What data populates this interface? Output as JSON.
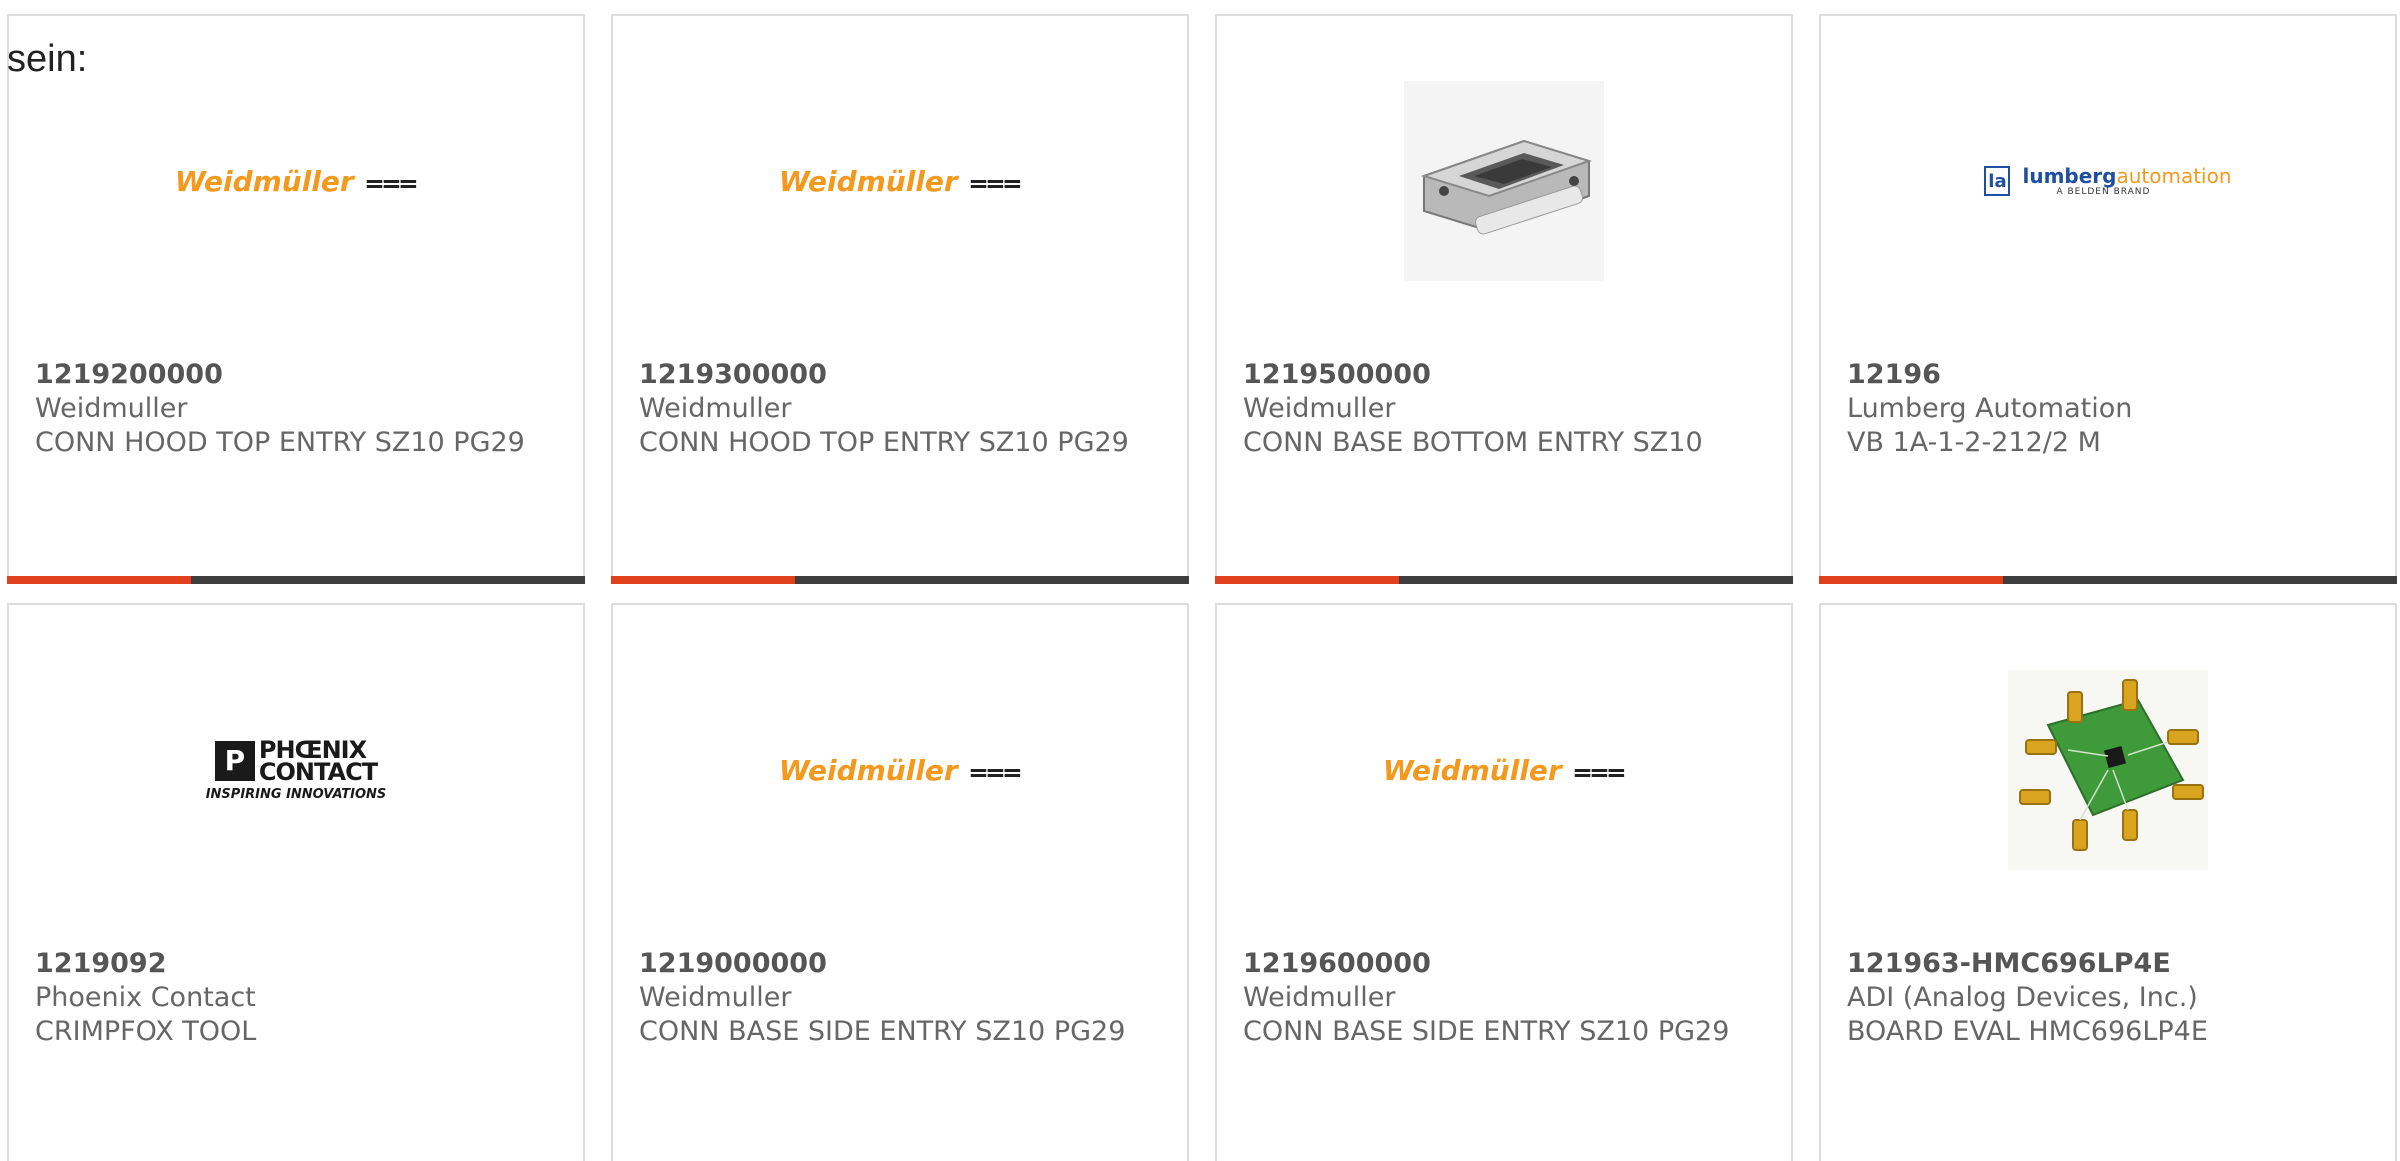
{
  "intro_text": "sein:",
  "colors": {
    "card_border": "#dddddd",
    "bar_dark": "#3e3e3e",
    "bar_accent": "#e0401c",
    "weidmuller_orange": "#f39a1e",
    "lumberg_blue": "#1f4fa0"
  },
  "logos": {
    "weidmuller": {
      "text": "Weidmüller",
      "mark": "⩶"
    },
    "lumberg": {
      "box": "la",
      "main": "lumberg",
      "main_accent": "automation",
      "sub": "A BELDEN BRAND"
    },
    "phoenix": {
      "box": "P",
      "line1": "PHŒNIX",
      "line2": "CONTACT",
      "sub": "INSPIRING INNOVATIONS"
    }
  },
  "cards": [
    {
      "part_number": "1219200000",
      "manufacturer": "Weidmuller",
      "description": "CONN HOOD TOP ENTRY SZ10 PG29",
      "image": "weidmuller-logo",
      "has_accent_bar": true
    },
    {
      "part_number": "1219300000",
      "manufacturer": "Weidmuller",
      "description": "CONN HOOD TOP ENTRY SZ10 PG29",
      "image": "weidmuller-logo",
      "has_accent_bar": true
    },
    {
      "part_number": "1219500000",
      "manufacturer": "Weidmuller",
      "description": "CONN BASE BOTTOM ENTRY SZ10",
      "image": "connector-base-photo",
      "has_accent_bar": true
    },
    {
      "part_number": "12196",
      "manufacturer": "Lumberg Automation",
      "description": "VB 1A-1-2-212/2 M",
      "image": "lumberg-logo",
      "has_accent_bar": true
    },
    {
      "part_number": "1219092",
      "manufacturer": "Phoenix Contact",
      "description": "CRIMPFOX TOOL",
      "image": "phoenix-contact-logo",
      "has_accent_bar": false
    },
    {
      "part_number": "1219000000",
      "manufacturer": "Weidmuller",
      "description": "CONN BASE SIDE ENTRY SZ10 PG29",
      "image": "weidmuller-logo",
      "has_accent_bar": false
    },
    {
      "part_number": "1219600000",
      "manufacturer": "Weidmuller",
      "description": "CONN BASE SIDE ENTRY SZ10 PG29",
      "image": "weidmuller-logo",
      "has_accent_bar": false
    },
    {
      "part_number": "121963-HMC696LP4E",
      "manufacturer": "ADI (Analog Devices, Inc.)",
      "description": "BOARD EVAL HMC696LP4E",
      "image": "eval-board-photo",
      "has_accent_bar": false
    }
  ]
}
